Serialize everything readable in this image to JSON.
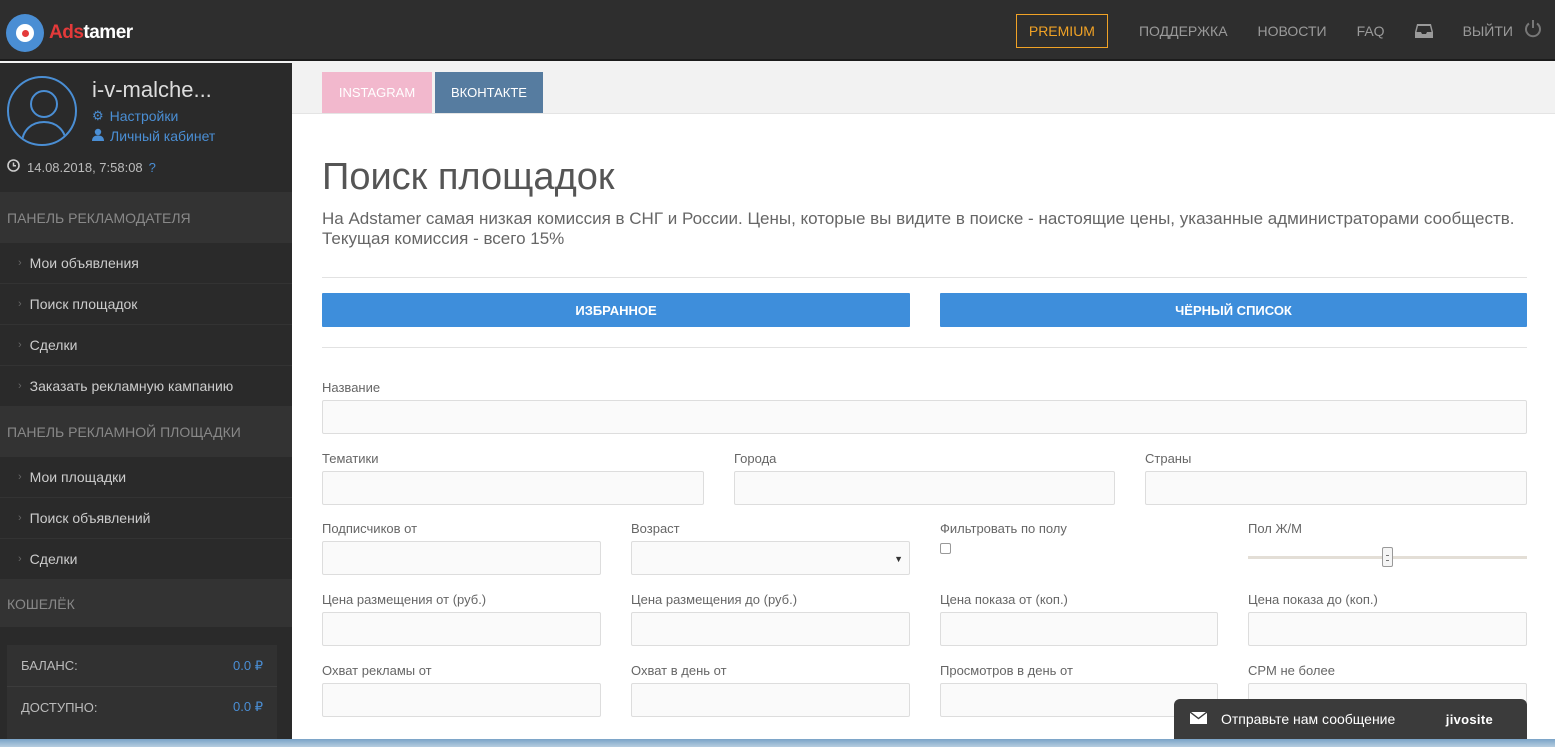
{
  "header": {
    "logo_text_red": "Ads",
    "logo_text_white": "tamer",
    "premium_label": "PREMIUM",
    "nav": [
      {
        "label": "ПОДДЕРЖКА"
      },
      {
        "label": "НОВОСТИ"
      },
      {
        "label": "FAQ"
      }
    ],
    "logout_label": "ВЫЙТИ"
  },
  "sidebar": {
    "username": "i-v-malche...",
    "settings_label": "Настройки",
    "cabinet_label": "Личный кабинет",
    "datetime": "14.08.2018, 7:58:08",
    "help_mark": "?",
    "advertiser_panel": {
      "title": "ПАНЕЛЬ РЕКЛАМОДАТЕЛЯ",
      "items": [
        "Мои объявления",
        "Поиск площадок",
        "Сделки",
        "Заказать рекламную кампанию"
      ]
    },
    "publisher_panel": {
      "title": "ПАНЕЛЬ РЕКЛАМНОЙ ПЛОЩАДКИ",
      "items": [
        "Мои площадки",
        "Поиск объявлений",
        "Сделки"
      ]
    },
    "wallet": {
      "title": "КОШЕЛЁК",
      "balance_label": "БАЛАНС:",
      "balance_value": "0.0 ₽",
      "available_label": "ДОСТУПНО:",
      "available_value": "0.0 ₽"
    }
  },
  "main": {
    "tabs": [
      "INSTAGRAM",
      "ВКОНТАКТЕ"
    ],
    "title": "Поиск площадок",
    "description": "На Adstamer самая низкая комиссия в СНГ и России. Цены, которые вы видите в поиске - настоящие цены, указанные администраторами сообществ. Текущая комиссия - всего 15%",
    "favorites_button": "ИЗБРАННОЕ",
    "blacklist_button": "ЧЁРНЫЙ СПИСОК",
    "fields": {
      "name": "Название",
      "topics": "Тематики",
      "cities": "Города",
      "countries": "Страны",
      "subscribers_from": "Подписчиков от",
      "age": "Возраст",
      "filter_gender": "Фильтровать по полу",
      "gender": "Пол Ж/М",
      "placement_price_from": "Цена размещения от (руб.)",
      "placement_price_to": "Цена размещения до (руб.)",
      "impression_price_from": "Цена показа от (коп.)",
      "impression_price_to": "Цена показа до (коп.)",
      "ad_reach_from": "Охват рекламы от",
      "daily_reach_from": "Охват в день от",
      "daily_views_from": "Просмотров в день от",
      "cpm_max": "CPM не более"
    },
    "gender_slider_position": 0.5
  },
  "chat": {
    "label": "Отправьте нам сообщение",
    "brand": "jivosite"
  },
  "colors": {
    "accent": "#3e8edb",
    "premium": "#f0a226",
    "instagram_tab": "#f2b8cd",
    "vk_tab": "#567ca0",
    "sidebar_bg": "#2a2a2a"
  }
}
